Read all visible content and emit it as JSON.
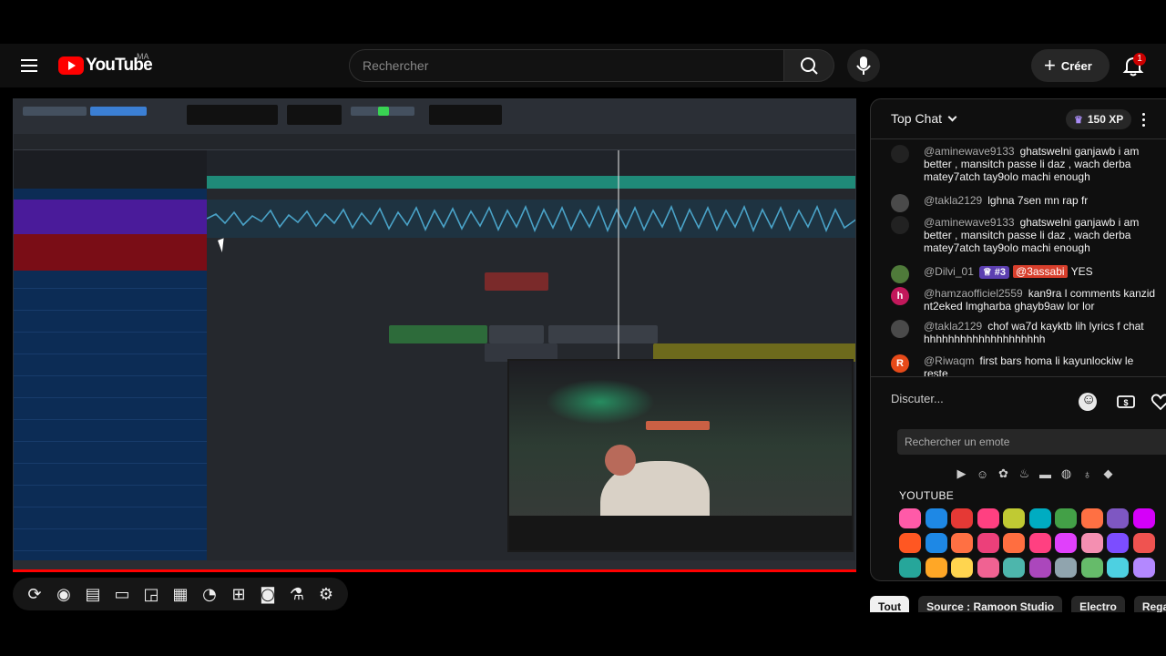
{
  "header": {
    "logo_text": "YouTube",
    "logo_country": "MA",
    "search_placeholder": "Rechercher",
    "create_label": "Créer",
    "notification_count": "1",
    "icons": [
      "menu-icon",
      "search-icon",
      "mic-icon",
      "plus-icon",
      "bell-icon"
    ]
  },
  "player": {
    "progress_fraction": 1.0,
    "controls": [
      {
        "name": "loop-icon"
      },
      {
        "name": "broadcast-icon"
      },
      {
        "name": "live-dvr-icon"
      },
      {
        "name": "clapperboard-icon"
      },
      {
        "name": "miniplayer-icon"
      },
      {
        "name": "subtitles-icon"
      },
      {
        "name": "speed-icon"
      },
      {
        "name": "add-clip-icon"
      },
      {
        "name": "screenshot-icon"
      },
      {
        "name": "lab-icon"
      },
      {
        "name": "settings-icon"
      }
    ]
  },
  "chat": {
    "title": "Top Chat",
    "xp_label": "150 XP",
    "messages": [
      {
        "author": "@aminewave9133",
        "text": "ghatswelni ganjawb i am better , mansitch passe li daz , wach derba matey7atch tay9olo machi enough",
        "avatar_letter": "",
        "avatar_color": "#222222"
      },
      {
        "author": "@takla2129",
        "text": "lghna 7sen mn rap fr",
        "avatar_letter": "",
        "avatar_color": "#4a4a4a"
      },
      {
        "author": "@aminewave9133",
        "text": "ghatswelni ganjawb i am better , mansitch passe li daz , wach derba matey7atch tay9olo machi enough",
        "avatar_letter": "",
        "avatar_color": "#222222"
      },
      {
        "author": "@Dilvi_01",
        "badge": "♕ #3",
        "mention": "@3assabi",
        "text": "YES",
        "avatar_letter": "",
        "avatar_color": "#4f7a3a"
      },
      {
        "author": "@hamzaofficiel2559",
        "text": "kan9ra l comments kanzid nt2eked lmgharba ghayb9aw lor lor",
        "avatar_letter": "h",
        "avatar_color": "#c2185b"
      },
      {
        "author": "@takla2129",
        "text": "chof wa7d kayktb lih lyrics f chat hhhhhhhhhhhhhhhhhhhh",
        "avatar_letter": "",
        "avatar_color": "#4a4a4a"
      },
      {
        "author": "@Riwaqm",
        "text": "first bars homa li kayunlockiw le reste",
        "avatar_letter": "R",
        "avatar_color": "#e64a19"
      }
    ],
    "input_placeholder": "Discuter...",
    "emote_search_placeholder": "Rechercher un emote",
    "emote_section": "YOUTUBE",
    "emote_categories": [
      "youtube-icon",
      "smiley-icon",
      "gear-emote-icon",
      "cake-icon",
      "car-icon",
      "basketball-icon",
      "lightbulb-icon",
      "diamond-icon"
    ],
    "emote_colors": [
      "#ff5aa8",
      "#1e88e5",
      "#e53935",
      "#ff4081",
      "#c0ca33",
      "#00acc1",
      "#43a047",
      "#ff7043",
      "#7e57c2",
      "#d500f9",
      "#ff5722",
      "#1e88e5",
      "#ff7043",
      "#ec407a",
      "#ff6e40",
      "#ff4081",
      "#e040fb",
      "#f48fb1",
      "#7c4dff",
      "#ef5350",
      "#26a69a",
      "#ffa726",
      "#ffd54f",
      "#f06292",
      "#4db6ac",
      "#ab47bc",
      "#90a4ae",
      "#66bb6a",
      "#4dd0e1",
      "#b388ff"
    ]
  },
  "chips": [
    "Tout",
    "Source : Ramoon Studio",
    "Electro",
    "Regar"
  ]
}
